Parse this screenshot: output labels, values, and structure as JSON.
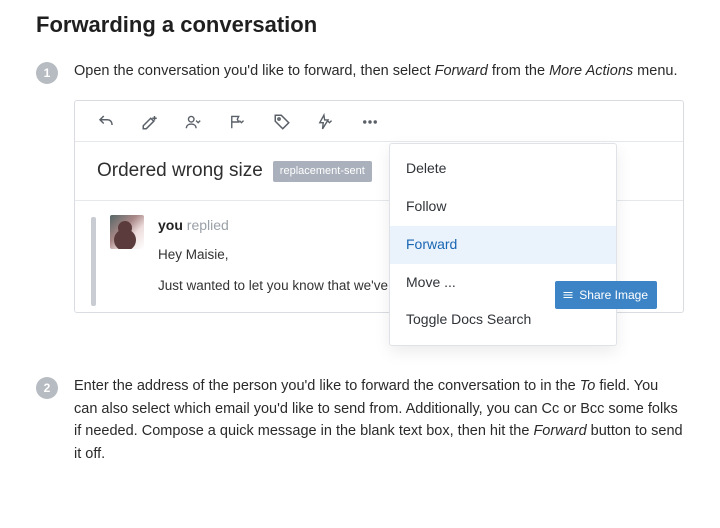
{
  "title": "Forwarding a conversation",
  "steps": {
    "s1": {
      "num": "1",
      "p1a": "Open the conversation you'd like to forward, then select ",
      "em1": "Forward",
      "p1b": " from the ",
      "em2": "More Actions",
      "p1c": " menu."
    },
    "s2": {
      "num": "2",
      "p1a": "Enter the address of the person you'd like to forward the conversation to in the ",
      "em1": "To",
      "p1b": " field. You can also select which email you'd like to send from. Additionally, you can Cc or Bcc some folks if needed. Compose a quick message in the blank text box, then hit the ",
      "em2": "Forward",
      "p1c": " button to send it off."
    }
  },
  "conversation": {
    "subject": "Ordered wrong size",
    "tag": "replacement-sent",
    "author_you": "you",
    "author_replied": " replied",
    "body_line1": "Hey Maisie,",
    "body_line2": "Just wanted to let you know that we've placed the missing pants in the mail a"
  },
  "menu": {
    "delete": "Delete",
    "follow": "Follow",
    "forward": "Forward",
    "move": "Move ...",
    "toggle": "Toggle Docs Search"
  },
  "share_button": "Share Image"
}
